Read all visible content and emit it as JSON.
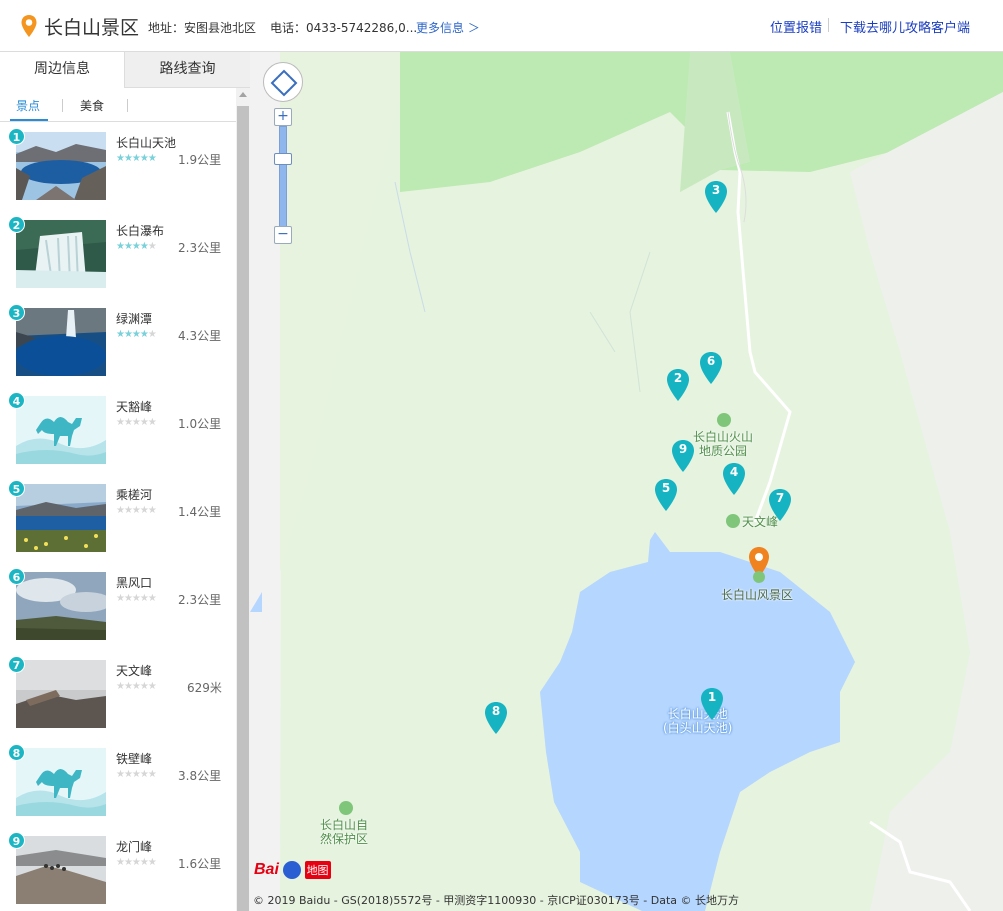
{
  "header": {
    "title": "长白山景区",
    "address": "地址：安图县池北区",
    "phone": "电话：0433-5742286,0...",
    "more": "更多信息 ＞",
    "report": "位置报错",
    "download": "下载去哪儿攻略客户端"
  },
  "sidebar": {
    "tabs": [
      "周边信息",
      "路线查询"
    ],
    "subtabs": [
      "景点",
      "美食"
    ],
    "items": [
      {
        "num": "1",
        "name": "长白山天池",
        "rating": 5,
        "distance": "1.9公里"
      },
      {
        "num": "2",
        "name": "长白瀑布",
        "rating": 4.5,
        "distance": "2.3公里"
      },
      {
        "num": "3",
        "name": "绿渊潭",
        "rating": 4.5,
        "distance": "4.3公里"
      },
      {
        "num": "4",
        "name": "天豁峰",
        "rating": 0,
        "distance": "1.0公里"
      },
      {
        "num": "5",
        "name": "乘槎河",
        "rating": 0,
        "distance": "1.4公里"
      },
      {
        "num": "6",
        "name": "黑风口",
        "rating": 0,
        "distance": "2.3公里"
      },
      {
        "num": "7",
        "name": "天文峰",
        "rating": 0,
        "distance": "629米"
      },
      {
        "num": "8",
        "name": "铁壁峰",
        "rating": 0,
        "distance": "3.8公里"
      },
      {
        "num": "9",
        "name": "龙门峰",
        "rating": 0,
        "distance": "1.6公里"
      }
    ]
  },
  "map": {
    "labels": {
      "geopark": [
        "长白山火山",
        "地质公园"
      ],
      "tianwen": "天文峰",
      "scenic": "长白山风景区",
      "lake": [
        "长白山天池",
        "(白头山天池)"
      ],
      "reserve": [
        "长白山自",
        "然保护区"
      ]
    },
    "zoom_in": "+",
    "zoom_out": "−",
    "logo_text": "Bai",
    "logo_suffix": "地图",
    "copyright": "© 2019 Baidu - GS(2018)5572号 - 甲测资字1100930 - 京ICP证030173号 - Data © 长地万方",
    "markers": [
      "1",
      "2",
      "3",
      "4",
      "5",
      "6",
      "7",
      "8",
      "9"
    ]
  },
  "colors": {
    "accent": "#1bb6c4",
    "link": "#1a3dc1",
    "lake": "#b5d6fe",
    "land": "#e3f5dd",
    "forest": "#bde9b2",
    "orange_pin": "#f0821f"
  }
}
